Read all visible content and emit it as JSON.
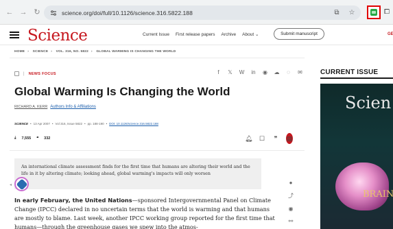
{
  "browser": {
    "url": "science.org/doi/full/10.1126/science.316.5822.188"
  },
  "header": {
    "logo": "Science",
    "nav": [
      "Current Issue",
      "First release papers",
      "Archive",
      "About ⌄"
    ],
    "submit_label": "Submit manuscript",
    "right_link": "GE"
  },
  "breadcrumb": [
    "HOME",
    "SCIENCE",
    "VOL. 316, NO. 5822",
    "GLOBAL WARMING IS CHANGING THE WORLD"
  ],
  "article": {
    "section": "NEWS FOCUS",
    "title": "Global Warming Is Changing the World",
    "author": "RICHARD A. KERR",
    "authors_link": "Authors Info & Affiliations",
    "journal": "SCIENCE",
    "date": "13 Apr 2007",
    "volume": "Vol 316, Issue 5822",
    "pages": "pp. 188-190",
    "doi": "DOI: 10.1126/science.316.5822.188",
    "views": "7,555",
    "citations": "332",
    "abstract": "An international climate assessment finds for the first time that humans are altering their world and the life in it by altering climate; looking ahead, global warming's impacts will only worsen",
    "body_lead": "In early February, the United Nations",
    "body_rest": "—sponsored Intergovernmental Panel on Climate Change (IPCC) declared in no uncertain terms that the world is warming and that humans are mostly to blame. Last week, another IPCC working group reported for the first time that humans—through the greenhouse gases we spew into the atmos-"
  },
  "sidebar": {
    "current_issue": "CURRENT ISSUE",
    "cover_word": "Scien",
    "cover_lower": "BRAIN"
  },
  "colors": {
    "brand": "#c6171e",
    "link": "#1a5dab",
    "highlight_box": "#e10000"
  }
}
